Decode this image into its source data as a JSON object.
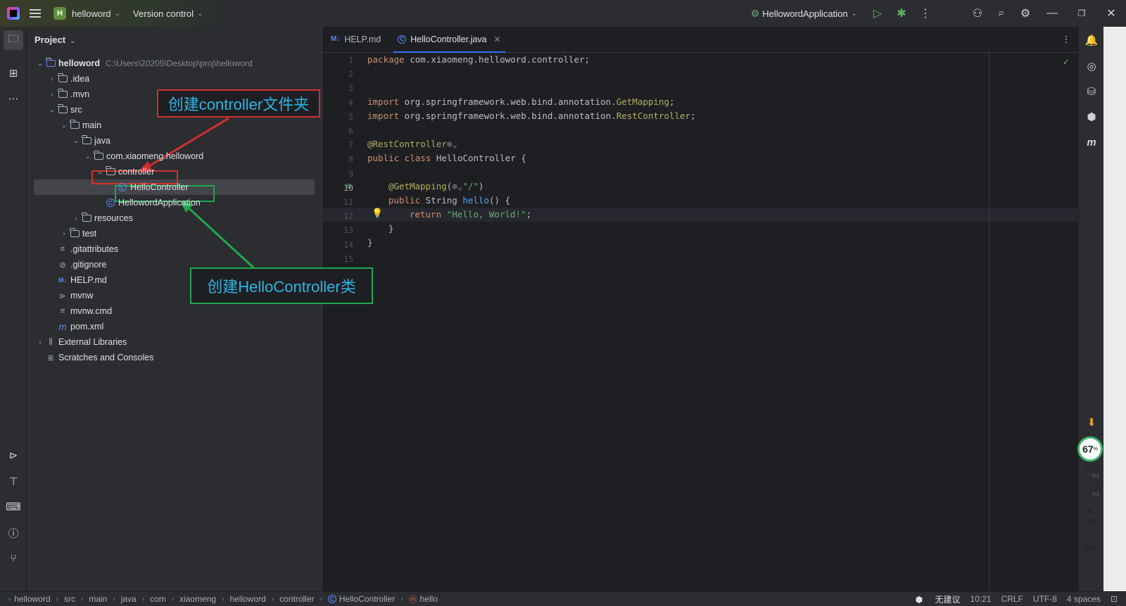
{
  "titlebar": {
    "project_badge": "H",
    "project_name": "helloword",
    "vcs_label": "Version control",
    "run_config": "HellowordApplication"
  },
  "project_panel": {
    "title": "Project",
    "tree": [
      {
        "label": "helloword",
        "hint": "C:\\Users\\20205\\Desktop\\proj\\helloword",
        "depth": 0,
        "arrow": "open",
        "icon": "module"
      },
      {
        "label": ".idea",
        "depth": 1,
        "arrow": "closed",
        "icon": "folder"
      },
      {
        "label": ".mvn",
        "depth": 1,
        "arrow": "closed",
        "icon": "folder"
      },
      {
        "label": "src",
        "depth": 1,
        "arrow": "open",
        "icon": "folder"
      },
      {
        "label": "main",
        "depth": 2,
        "arrow": "open",
        "icon": "folder"
      },
      {
        "label": "java",
        "depth": 3,
        "arrow": "open",
        "icon": "folder"
      },
      {
        "label": "com.xiaomeng.helloword",
        "depth": 4,
        "arrow": "open",
        "icon": "package"
      },
      {
        "label": "controller",
        "depth": 5,
        "arrow": "open",
        "icon": "package"
      },
      {
        "label": "HelloController",
        "depth": 6,
        "arrow": "none",
        "icon": "class",
        "selected": true
      },
      {
        "label": "HellowordApplication",
        "depth": 5,
        "arrow": "none",
        "icon": "app-class"
      },
      {
        "label": "resources",
        "depth": 3,
        "arrow": "closed",
        "icon": "folder"
      },
      {
        "label": "test",
        "depth": 2,
        "arrow": "closed",
        "icon": "folder"
      },
      {
        "label": ".gitattributes",
        "depth": 1,
        "arrow": "none",
        "icon": "text-file"
      },
      {
        "label": ".gitignore",
        "depth": 1,
        "arrow": "none",
        "icon": "ignore-file"
      },
      {
        "label": "HELP.md",
        "depth": 1,
        "arrow": "none",
        "icon": "markdown"
      },
      {
        "label": "mvnw",
        "depth": 1,
        "arrow": "none",
        "icon": "shell"
      },
      {
        "label": "mvnw.cmd",
        "depth": 1,
        "arrow": "none",
        "icon": "text-file"
      },
      {
        "label": "pom.xml",
        "depth": 1,
        "arrow": "none",
        "icon": "maven"
      },
      {
        "label": "External Libraries",
        "depth": 0,
        "arrow": "closed",
        "icon": "libraries"
      },
      {
        "label": "Scratches and Consoles",
        "depth": 0,
        "arrow": "none",
        "icon": "scratches"
      }
    ]
  },
  "annotations": {
    "folder_note": "创建controller文件夹",
    "class_note": "创建HelloController类",
    "red": "#d32f2f",
    "green": "#1fa84f"
  },
  "editor": {
    "tabs": [
      {
        "label": "HELP.md",
        "icon": "M↓",
        "active": false
      },
      {
        "label": "HelloController.java",
        "icon": "C",
        "active": true
      }
    ],
    "current_line": 10,
    "lines": [
      "1",
      "2",
      "3",
      "4",
      "5",
      "6",
      "7",
      "8",
      "9",
      "10",
      "11",
      "12",
      "13",
      "14",
      "15"
    ],
    "code": {
      "l1a": "package",
      "l1b": " com.xiaomeng.helloword.controller;",
      "l4a": "import",
      "l4b": " org.springframework.web.bind.annotation.",
      "l4c": "GetMapping",
      "l4d": ";",
      "l5a": "import",
      "l5b": " org.springframework.web.bind.annotation.",
      "l5c": "RestController",
      "l5d": ";",
      "l7a": "@RestController",
      "l7b": "⊕⌄",
      "l8a": "public class",
      "l8b": " HelloController {",
      "l10a": "@GetMapping",
      "l10b": "(",
      "l10c": "⊕⌄",
      "l10d": "\"/\"",
      "l10e": ")",
      "l11a": "public",
      "l11b": " String ",
      "l11c": "hello",
      "l11d": "() {",
      "l12a": "return",
      "l12b": " ",
      "l12c": "\"Hello, World!\"",
      "l12d": ";",
      "l13": "}",
      "l14": "}"
    }
  },
  "right_ext": {
    "gauge": "67",
    "gauge_unit": "%",
    "up_speed": "87.4",
    "down_speed": "17.6",
    "speed_unit": "K/s",
    "yuanbao": "元宝",
    "screenshot": "截图"
  },
  "statusbar": {
    "breadcrumbs": [
      "helloword",
      "src",
      "main",
      "java",
      "com",
      "xiaomeng",
      "helloword",
      "controller",
      "HelloController",
      "hello"
    ],
    "ai_hint": "无建议",
    "position": "10:21",
    "line_sep": "CRLF",
    "encoding": "UTF-8",
    "indent": "4 spaces"
  }
}
